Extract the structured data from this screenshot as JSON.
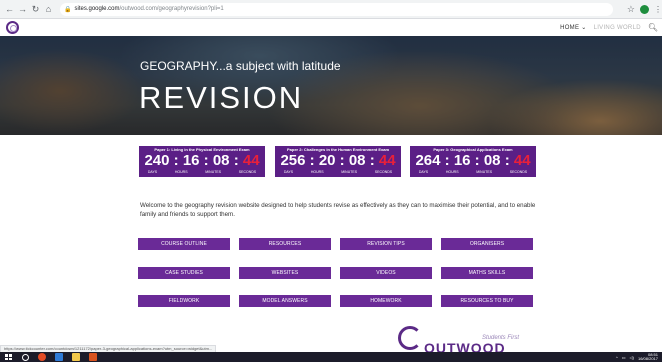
{
  "browser": {
    "url_host": "sites.google.com",
    "url_path": "/outwood.com/geographyrevision?pli=1"
  },
  "site_nav": {
    "home": "HOME ⌄",
    "world": "LIVING WORLD"
  },
  "hero": {
    "subtitle": "GEOGRAPHY...a subject with latitude",
    "title": "REVISION"
  },
  "countdowns": [
    {
      "title": "Paper 1: Living in the Physical Environment Exam",
      "days": "240",
      "hours": "16",
      "minutes": "08",
      "seconds": "44"
    },
    {
      "title": "Paper 2: Challenges in the Human Environment Exam",
      "days": "256",
      "hours": "20",
      "minutes": "08",
      "seconds": "44"
    },
    {
      "title": "Paper 3: Geographical Applications Exam",
      "days": "264",
      "hours": "16",
      "minutes": "08",
      "seconds": "44"
    }
  ],
  "countdown_units": {
    "days": "DAYS",
    "hours": "HOURS",
    "minutes": "MINUTES",
    "seconds": "SECONDS"
  },
  "welcome_text": "Welcome to the geography revision website designed to help students revise as effectively as they can to maximise their potential, and to enable family and friends to support them.",
  "buttons": [
    "COURSE OUTLINE",
    "RESOURCES",
    "REVISION TIPS",
    "ORGANISERS",
    "CASE STUDIES",
    "WEBSITES",
    "VIDEOS",
    "MATHS SKILLS",
    "FIELDWORK",
    "MODEL ANSWERS",
    "HOMEWORK",
    "RESOURCES TO BUY"
  ],
  "footer": {
    "tagline": "Students First",
    "name": "OUTWOOD"
  },
  "status_url": "https://www.tickcounter.com/countdown/1211172/paper-3-geographical-applications-exam?utm_source=widget&utm...",
  "taskbar": {
    "time": "08:51",
    "date": "16/08/2017"
  },
  "colors": {
    "accent_purple": "#5b1f86",
    "button_purple": "#6a2a97",
    "seconds_red": "#e8203a"
  }
}
